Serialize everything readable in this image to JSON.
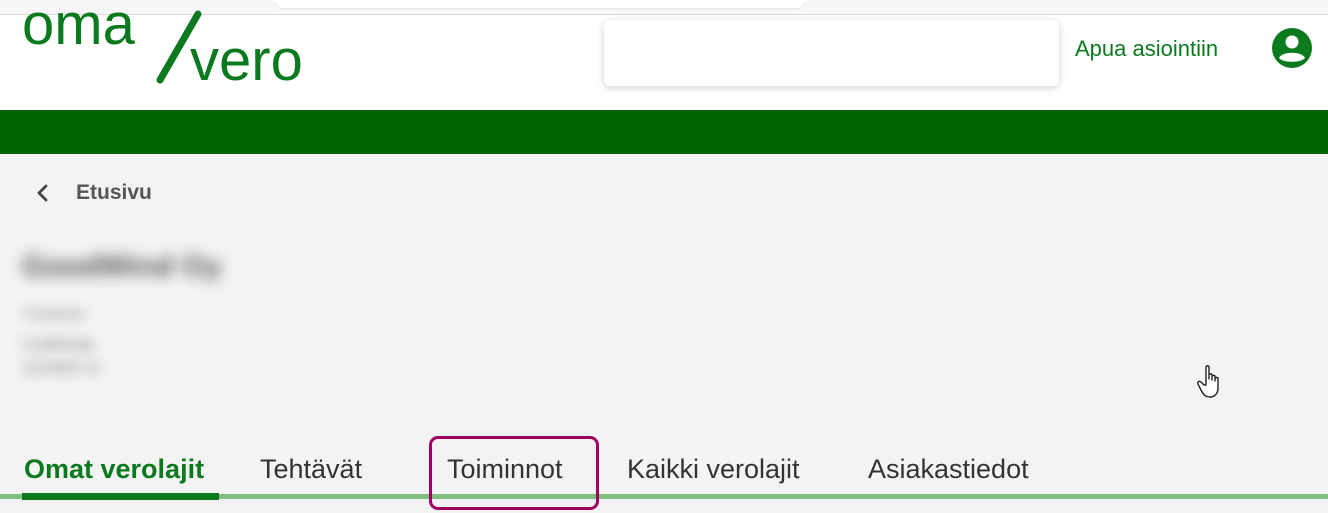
{
  "header": {
    "logo_text_top": "oma",
    "logo_text_bottom": "vero",
    "help_link": "Apua asiointiin",
    "search": {
      "value": ""
    }
  },
  "breadcrumb": {
    "back_label": "Etusivu"
  },
  "company": {
    "name": "GoodWind Oy",
    "line1": "Y-tunnus",
    "line2": "Lisätietoja",
    "line3": "1234567-8"
  },
  "tabs": [
    {
      "label": "Omat verolajit",
      "active": true
    },
    {
      "label": "Tehtävät",
      "active": false
    },
    {
      "label": "Toiminnot",
      "active": false,
      "highlighted": true
    },
    {
      "label": "Kaikki verolajit",
      "active": false
    },
    {
      "label": "Asiakastiedot",
      "active": false
    }
  ],
  "colors": {
    "brand_green": "#0b7a1e",
    "band_green": "#006400",
    "tab_line": "#7fbf7f",
    "highlight": "#a00060"
  },
  "icons": {
    "user": "account-circle-icon",
    "back": "chevron-left-icon",
    "cursor": "hand-pointer-icon"
  }
}
